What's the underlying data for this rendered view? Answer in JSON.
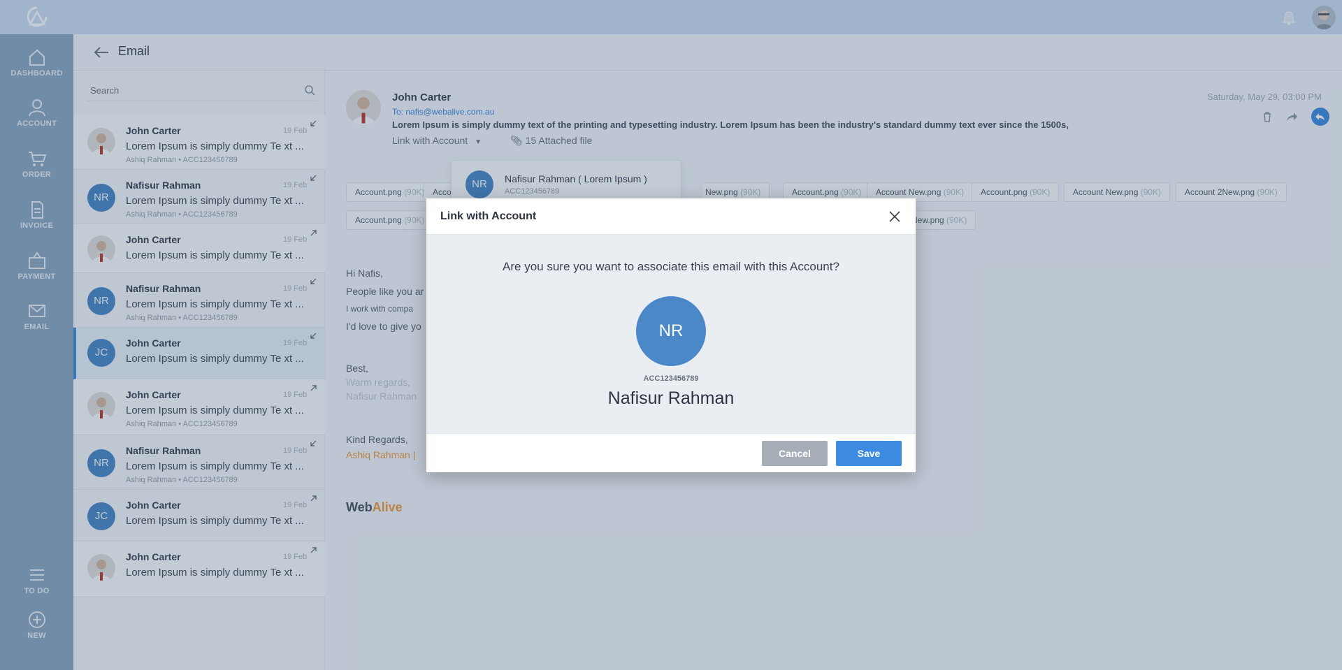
{
  "app": {
    "logo_icon": "app-logo-icon",
    "notification_icon": "bell-icon",
    "user_avatar_icon": "user-avatar"
  },
  "nav": [
    {
      "label": "DASHBOARD",
      "icon": "home-icon"
    },
    {
      "label": "ACCOUNT",
      "icon": "user-icon"
    },
    {
      "label": "ORDER",
      "icon": "cart-icon"
    },
    {
      "label": "INVOICE",
      "icon": "document-icon"
    },
    {
      "label": "PAYMENT",
      "icon": "payment-icon"
    },
    {
      "label": "EMAIL",
      "icon": "mail-icon"
    },
    {
      "label": "TO DO",
      "icon": "list-icon"
    },
    {
      "label": "NEW",
      "icon": "plus-icon"
    }
  ],
  "page": {
    "title": "Email"
  },
  "search": {
    "placeholder": "Search"
  },
  "emails": [
    {
      "name": "John Carter",
      "date": "19 Feb",
      "preview": "Lorem Ipsum is simply dummy Te xt ...",
      "meta": "Ashiq Rahman  •  ACC123456789",
      "avatar": "photo"
    },
    {
      "name": "Nafisur Rahman",
      "date": "19 Feb",
      "preview": "Lorem Ipsum is simply dummy Te xt ...",
      "meta": "Ashiq Rahman  •  ACC123456789",
      "avatar": "NR"
    },
    {
      "name": "John Carter",
      "date": "19 Feb",
      "preview": "Lorem Ipsum is simply dummy Te xt ...",
      "meta": "",
      "avatar": "photo"
    },
    {
      "name": "Nafisur Rahman",
      "date": "19 Feb",
      "preview": "Lorem Ipsum is simply dummy Te xt ...",
      "meta": "Ashiq Rahman  •  ACC123456789",
      "avatar": "NR"
    },
    {
      "name": "John Carter",
      "date": "19 Feb",
      "preview": "Lorem Ipsum is simply dummy Te xt ...",
      "meta": "",
      "avatar": "JC"
    },
    {
      "name": "John Carter",
      "date": "19 Feb",
      "preview": "Lorem Ipsum is simply dummy Te xt ...",
      "meta": "Ashiq Rahman  •  ACC123456789",
      "avatar": "photo"
    },
    {
      "name": "Nafisur Rahman",
      "date": "19 Feb",
      "preview": "Lorem Ipsum is simply dummy Te xt ...",
      "meta": "Ashiq Rahman  •  ACC123456789",
      "avatar": "NR"
    },
    {
      "name": "John Carter",
      "date": "19 Feb",
      "preview": "Lorem Ipsum is simply dummy Te xt ...",
      "meta": "",
      "avatar": "JC"
    },
    {
      "name": "John Carter",
      "date": "19 Feb",
      "preview": "Lorem Ipsum is simply dummy Te xt ...",
      "meta": "",
      "avatar": "photo"
    }
  ],
  "detail": {
    "sender": "John Carter",
    "to": "To: nafis@webalive.com.au",
    "snippet": "Lorem Ipsum is simply dummy text of the printing and typesetting industry. Lorem Ipsum has been the industry's standard dummy text ever since the 1500s,",
    "link_label": "Link with Account",
    "attached": "15 Attached file",
    "date": "Saturday, May 29, 03:00 PM",
    "attachments": [
      {
        "name": "Account.png",
        "size": "(90K)"
      },
      {
        "name": "Account",
        "size": ""
      },
      {
        "name": "New.png",
        "size": "(90K)"
      },
      {
        "name": "Account.png",
        "size": "(90K)"
      },
      {
        "name": "Account New.png",
        "size": "(90K)"
      },
      {
        "name": "Account.png",
        "size": "(90K)"
      },
      {
        "name": "Account New.png",
        "size": "(90K)"
      },
      {
        "name": "Account 2New.png",
        "size": "(90K)"
      },
      {
        "name": "Account.png",
        "size": "(90K)"
      },
      {
        "name": "New.png",
        "size": "(90K)"
      }
    ],
    "dropdown": {
      "initials": "NR",
      "name": "Nafisur Rahman ( Lorem Ipsum )",
      "code": "ACC123456789"
    },
    "body": {
      "greeting": "Hi Nafis,",
      "line1": "People like you ar",
      "line2": "I work with compa",
      "line3": "I'd love to give yo",
      "best": "Best,",
      "warm": "Warm regards,",
      "sig_name": "Nafisur Rahman",
      "kind": "Kind Regards,",
      "kind_name": "Ashiq Rahman |",
      "brand_a": "Web",
      "brand_b": "Alive"
    }
  },
  "modal": {
    "title": "Link with Account",
    "question": "Are you sure you want to associate this email with this Account?",
    "initials": "NR",
    "account_code": "ACC123456789",
    "account_name": "Nafisur Rahman",
    "cancel_label": "Cancel",
    "save_label": "Save"
  },
  "colors": {
    "accent": "#3d8be0",
    "avatar_blue": "#4a88c7",
    "cancel_grey": "#a7adb6",
    "brand_orange": "#f29a38"
  }
}
